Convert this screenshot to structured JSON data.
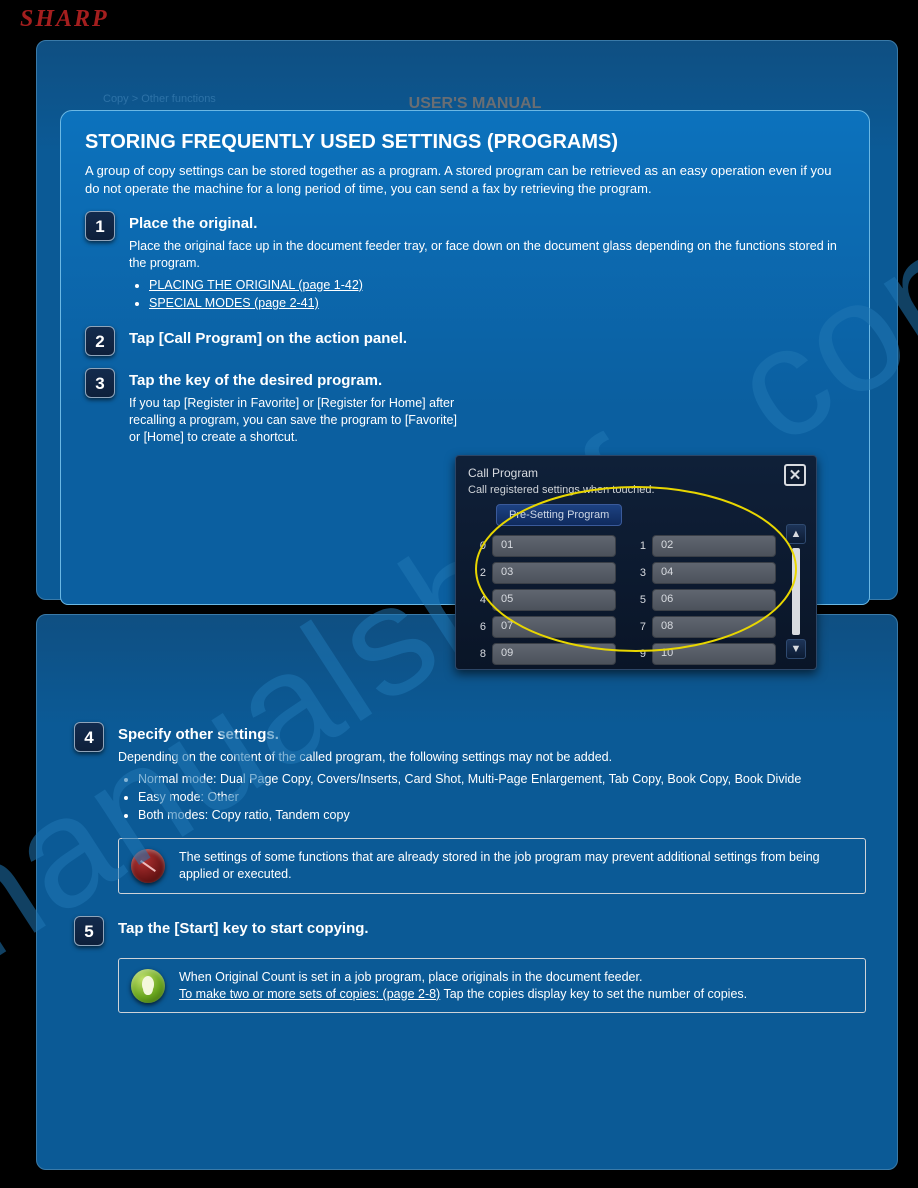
{
  "brand": "SHARP",
  "breadcrumb": "Copy > Other functions",
  "doc_title": "USER'S MANUAL",
  "watermark": "manualshelf . com",
  "panel": {
    "title": "STORING FREQUENTLY USED SETTINGS (PROGRAMS)",
    "intro": "A group of copy settings can be stored together as a program. A stored program can be retrieved as an easy operation even if you do not operate the machine for a long period of time, you can send a fax by retrieving the program."
  },
  "steps": {
    "s1": {
      "num": "1",
      "title": "Place the original.",
      "p": "Place the original face up in the document feeder tray, or face down on the document glass depending on the functions stored in the program.",
      "links": {
        "a": "PLACING THE ORIGINAL (page 1-42)",
        "b": "SPECIAL MODES (page 2-41)"
      }
    },
    "s2": {
      "num": "2",
      "title": "Tap [Call Program] on the action panel."
    },
    "s3": {
      "num": "3",
      "title": "Tap the key of the desired program.",
      "p": "If you tap [Register in Favorite] or [Register for Home] after recalling a program, you can save the program to [Favorite] or [Home] to create a shortcut."
    },
    "s4": {
      "num": "4",
      "title": "Specify other settings.",
      "intro": "Depending on the content of the called program, the following settings may not be added.",
      "bullets": [
        "Normal mode: Dual Page Copy, Covers/Inserts, Card Shot, Multi-Page Enlargement, Tab Copy, Book Copy, Book Divide",
        "Easy mode: Other",
        "Both modes: Copy ratio, Tandem copy"
      ]
    },
    "s5": {
      "num": "5",
      "title": "Tap the [Start] key to start copying."
    },
    "note_stop": "The settings of some functions that are already stored in the job program may prevent additional settings from being applied or executed.",
    "note_tip_a": "When Original Count is set in a job program, place originals in the document feeder.",
    "note_tip_link": "To make two or more sets of copies: (page 2-8)",
    "note_tip_b": "Tap the copies display key to set the number of copies."
  },
  "dialog": {
    "title": "Call Program",
    "subtitle": "Call registered settings when touched.",
    "pre_btn": "Pre-Setting Program",
    "items": [
      {
        "n": "0",
        "v": "01"
      },
      {
        "n": "1",
        "v": "02"
      },
      {
        "n": "2",
        "v": "03"
      },
      {
        "n": "3",
        "v": "04"
      },
      {
        "n": "4",
        "v": "05"
      },
      {
        "n": "5",
        "v": "06"
      },
      {
        "n": "6",
        "v": "07"
      },
      {
        "n": "7",
        "v": "08"
      },
      {
        "n": "8",
        "v": "09"
      },
      {
        "n": "9",
        "v": "10"
      }
    ]
  }
}
